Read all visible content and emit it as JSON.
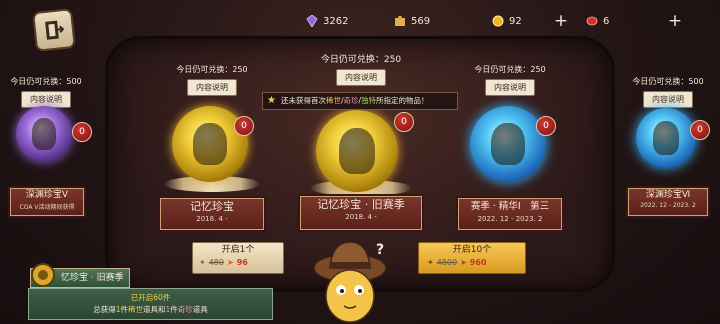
{
  "currencies": [
    {
      "icon": "purple-gem-icon",
      "color": "#9a62e0",
      "value": "3262",
      "has_plus": false
    },
    {
      "icon": "puzzle-piece-icon",
      "color": "#e0b34a",
      "value": "569",
      "has_plus": false
    },
    {
      "icon": "gold-coin-icon",
      "color": "#f2b31f",
      "value": "92",
      "has_plus": true
    },
    {
      "icon": "red-gem-icon",
      "color": "#cf2f2f",
      "value": "6",
      "has_plus": true
    }
  ],
  "tooltip": {
    "prefix": "还未获得首次",
    "tag1": "稀世",
    "sep1": "/",
    "tag2": "奇珍",
    "sep2": "/",
    "tag3": "独特",
    "suffix": "所指定的物品！"
  },
  "cards": [
    {
      "id": "far-left",
      "remain": "今日仍可兑换：500",
      "desc": "内容说明",
      "badge": "0",
      "name": "深渊珍宝V",
      "date": "COA Ⅴ活动期间获得",
      "orb": "purple"
    },
    {
      "id": "left",
      "remain": "今日仍可兑换：250",
      "desc": "内容说明",
      "badge": "0",
      "name": "记忆珍宝",
      "date": "2018. 4 -",
      "orb": "gold"
    },
    {
      "id": "center",
      "remain": "今日仍可兑换：250",
      "desc": "内容说明",
      "badge": "0",
      "name": "记忆珍宝 · 旧赛季",
      "date": "2018. 4 -",
      "orb": "gold"
    },
    {
      "id": "right",
      "remain": "今日仍可兑换：250",
      "desc": "内容说明",
      "badge": "0",
      "name": "赛季 · 精华Ⅰ　第三",
      "date": "2022. 12 - 2023. 2",
      "orb": "blue"
    },
    {
      "id": "far-right",
      "remain": "今日仍可兑换：500",
      "desc": "内容说明",
      "badge": "0",
      "name": "深渊珍宝Ⅵ",
      "date": "2022. 12 - 2023. 2",
      "orb": "blue"
    }
  ],
  "open_one": {
    "label": "开启1个",
    "old_cost": "480",
    "new_cost": "96"
  },
  "open_ten": {
    "label": "开启10个",
    "old_cost": "4800",
    "new_cost": "960"
  },
  "info": {
    "title": "忆珍宝 · 旧赛季",
    "line1": "已开启60件",
    "line2_a": "总获得",
    "line2_n1": "1",
    "line2_b": "件",
    "line2_t1": "稀世",
    "line2_c": "道具和",
    "line2_n2": "1",
    "line2_d": "件",
    "line2_t2": "奇珍",
    "line2_e": "道具"
  }
}
